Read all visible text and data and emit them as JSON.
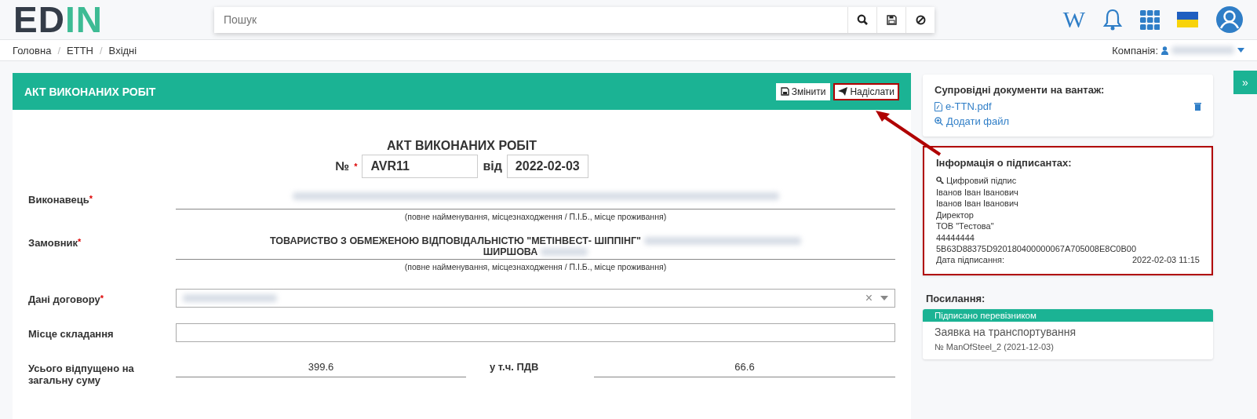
{
  "header": {
    "logo": [
      {
        "text": "ED",
        "color": "#343c48"
      },
      {
        "text": "IN",
        "color": "#3dbb94"
      }
    ],
    "search": {
      "placeholder": "Пошук"
    },
    "wiki_label": "W"
  },
  "breadcrumb_separator": "/",
  "required_mark": "*",
  "breadcrumbs": [
    {
      "label": "Головна"
    },
    {
      "label": "ЕТТН"
    },
    {
      "label": "Вхідні"
    }
  ],
  "company": {
    "label": "Компанія:",
    "redacted": true
  },
  "document": {
    "title": "АКТ ВИКОНАНИХ РОБІТ",
    "buttons": [
      {
        "label": "Змінити",
        "kind": "edit",
        "highlighted": false
      },
      {
        "label": "Надіслати",
        "kind": "send",
        "highlighted": true
      }
    ],
    "form_title": "АКТ ВИКОНАНИХ РОБІТ",
    "number_label": "№",
    "number": "AVR11",
    "date_label": "від",
    "date": "2022-02-03",
    "fields": [
      {
        "kind": "party",
        "label": "Виконавець",
        "required": true,
        "lines": [
          {
            "redacted": true
          }
        ],
        "hint": "(повне найменування, місцезнаходження / П.І.Б., місце проживання)"
      },
      {
        "kind": "party",
        "label": "Замовник",
        "required": true,
        "lines": [
          {
            "text": "ТОВАРИСТВО З ОБМЕЖЕНОЮ ВІДПОВІДАЛЬНІСТЮ \"МЕТІНВЕСТ- ШІППІНГ\"",
            "redacted": true
          },
          {
            "text": "ШИРШОВА",
            "redacted": true
          }
        ],
        "hint": "(повне найменування, місцезнаходження / П.І.Б., місце проживання)"
      },
      {
        "kind": "select",
        "label": "Дані договору",
        "required": true,
        "redacted": true,
        "clear": "×"
      },
      {
        "kind": "input",
        "label": "Місце складання",
        "required": false
      },
      {
        "kind": "totals",
        "label": "Усього відпущено на загальну суму",
        "required": false,
        "value": "399.6",
        "vat_label": "у т.ч. ПДВ",
        "vat_value": "66.6"
      }
    ]
  },
  "sidebar": {
    "expand_label": "»",
    "documents": {
      "title": "Супровідні документи на вантаж:",
      "files": [
        {
          "name": "e-TTN.pdf"
        }
      ],
      "add_label": "Додати файл"
    },
    "signers": {
      "title": "Інформація о підписантах:",
      "highlighted": true,
      "signature_label": "Цифровий підпис",
      "lines": [
        "Іванов Іван Іванович",
        "Іванов Іван Іванович",
        "Директор",
        "ТОВ \"Тестова\"",
        "44444444",
        "5B63D88375D920180400000067A705008E8C0B00"
      ],
      "date_label": "Дата підписання:",
      "date_value": "2022-02-03 11:15"
    },
    "links": {
      "title": "Посилання:",
      "items": [
        {
          "status": "Підписано перевізником",
          "title": "Заявка на транспортування",
          "number": "№ ManOfSteel_2 (2021-12-03)"
        }
      ]
    }
  }
}
